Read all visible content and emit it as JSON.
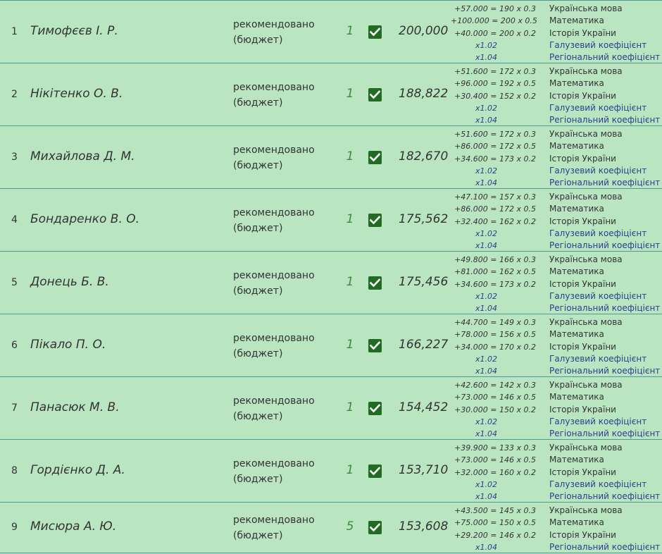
{
  "rows": [
    {
      "num": "1",
      "name": "Тимофєєв І. Р.",
      "status_line1": "рекомендовано",
      "status_line2": "(бюджет)",
      "priority": "1",
      "score": "200,000",
      "details": [
        {
          "formula": "+57.000 = 190 x 0.3",
          "subject": "Українська мова"
        },
        {
          "formula": "+100.000 = 200 x 0.5",
          "subject": "Математика"
        },
        {
          "formula": "+40.000 = 200 x 0.2",
          "subject": "Історія України"
        },
        {
          "formula": "x1.02",
          "subject": "Галузевий коефіцієнт",
          "coef": true
        },
        {
          "formula": "x1.04",
          "subject": "Регіональний коефіцієнт",
          "coef": true
        }
      ]
    },
    {
      "num": "2",
      "name": "Нікітенко О. В.",
      "status_line1": "рекомендовано",
      "status_line2": "(бюджет)",
      "priority": "1",
      "score": "188,822",
      "details": [
        {
          "formula": "+51.600 = 172 x 0.3",
          "subject": "Українська мова"
        },
        {
          "formula": "+96.000 = 192 x 0.5",
          "subject": "Математика"
        },
        {
          "formula": "+30.400 = 152 x 0.2",
          "subject": "Історія України"
        },
        {
          "formula": "x1.02",
          "subject": "Галузевий коефіцієнт",
          "coef": true
        },
        {
          "formula": "x1.04",
          "subject": "Регіональний коефіцієнт",
          "coef": true
        }
      ]
    },
    {
      "num": "3",
      "name": "Михайлова Д. М.",
      "status_line1": "рекомендовано",
      "status_line2": "(бюджет)",
      "priority": "1",
      "score": "182,670",
      "details": [
        {
          "formula": "+51.600 = 172 x 0.3",
          "subject": "Українська мова"
        },
        {
          "formula": "+86.000 = 172 x 0.5",
          "subject": "Математика"
        },
        {
          "formula": "+34.600 = 173 x 0.2",
          "subject": "Історія України"
        },
        {
          "formula": "x1.02",
          "subject": "Галузевий коефіцієнт",
          "coef": true
        },
        {
          "formula": "x1.04",
          "subject": "Регіональний коефіцієнт",
          "coef": true
        }
      ]
    },
    {
      "num": "4",
      "name": "Бондаренко В. О.",
      "status_line1": "рекомендовано",
      "status_line2": "(бюджет)",
      "priority": "1",
      "score": "175,562",
      "details": [
        {
          "formula": "+47.100 = 157 x 0.3",
          "subject": "Українська мова"
        },
        {
          "formula": "+86.000 = 172 x 0.5",
          "subject": "Математика"
        },
        {
          "formula": "+32.400 = 162 x 0.2",
          "subject": "Історія України"
        },
        {
          "formula": "x1.02",
          "subject": "Галузевий коефіцієнт",
          "coef": true
        },
        {
          "formula": "x1.04",
          "subject": "Регіональний коефіцієнт",
          "coef": true
        }
      ]
    },
    {
      "num": "5",
      "name": "Донець Б. В.",
      "status_line1": "рекомендовано",
      "status_line2": "(бюджет)",
      "priority": "1",
      "score": "175,456",
      "details": [
        {
          "formula": "+49.800 = 166 x 0.3",
          "subject": "Українська мова"
        },
        {
          "formula": "+81.000 = 162 x 0.5",
          "subject": "Математика"
        },
        {
          "formula": "+34.600 = 173 x 0.2",
          "subject": "Історія України"
        },
        {
          "formula": "x1.02",
          "subject": "Галузевий коефіцієнт",
          "coef": true
        },
        {
          "formula": "x1.04",
          "subject": "Регіональний коефіцієнт",
          "coef": true
        }
      ]
    },
    {
      "num": "6",
      "name": "Пікало П. О.",
      "status_line1": "рекомендовано",
      "status_line2": "(бюджет)",
      "priority": "1",
      "score": "166,227",
      "details": [
        {
          "formula": "+44.700 = 149 x 0.3",
          "subject": "Українська мова"
        },
        {
          "formula": "+78.000 = 156 x 0.5",
          "subject": "Математика"
        },
        {
          "formula": "+34.000 = 170 x 0.2",
          "subject": "Історія України"
        },
        {
          "formula": "x1.02",
          "subject": "Галузевий коефіцієнт",
          "coef": true
        },
        {
          "formula": "x1.04",
          "subject": "Регіональний коефіцієнт",
          "coef": true
        }
      ]
    },
    {
      "num": "7",
      "name": "Панасюк М. В.",
      "status_line1": "рекомендовано",
      "status_line2": "(бюджет)",
      "priority": "1",
      "score": "154,452",
      "details": [
        {
          "formula": "+42.600 = 142 x 0.3",
          "subject": "Українська мова"
        },
        {
          "formula": "+73.000 = 146 x 0.5",
          "subject": "Математика"
        },
        {
          "formula": "+30.000 = 150 x 0.2",
          "subject": "Історія України"
        },
        {
          "formula": "x1.02",
          "subject": "Галузевий коефіцієнт",
          "coef": true
        },
        {
          "formula": "x1.04",
          "subject": "Регіональний коефіцієнт",
          "coef": true
        }
      ]
    },
    {
      "num": "8",
      "name": "Гордієнко Д. А.",
      "status_line1": "рекомендовано",
      "status_line2": "(бюджет)",
      "priority": "1",
      "score": "153,710",
      "details": [
        {
          "formula": "+39.900 = 133 x 0.3",
          "subject": "Українська мова"
        },
        {
          "formula": "+73.000 = 146 x 0.5",
          "subject": "Математика"
        },
        {
          "formula": "+32.000 = 160 x 0.2",
          "subject": "Історія України"
        },
        {
          "formula": "x1.02",
          "subject": "Галузевий коефіцієнт",
          "coef": true
        },
        {
          "formula": "x1.04",
          "subject": "Регіональний коефіцієнт",
          "coef": true
        }
      ]
    },
    {
      "num": "9",
      "name": "Мисюра А. Ю.",
      "status_line1": "рекомендовано",
      "status_line2": "(бюджет)",
      "priority": "5",
      "score": "153,608",
      "details": [
        {
          "formula": "+43.500 = 145 x 0.3",
          "subject": "Українська мова"
        },
        {
          "formula": "+75.000 = 150 x 0.5",
          "subject": "Математика"
        },
        {
          "formula": "+29.200 = 146 x 0.2",
          "subject": "Історія України"
        },
        {
          "formula": "x1.04",
          "subject": "Регіональний коефіцієнт",
          "coef": true
        }
      ]
    }
  ]
}
